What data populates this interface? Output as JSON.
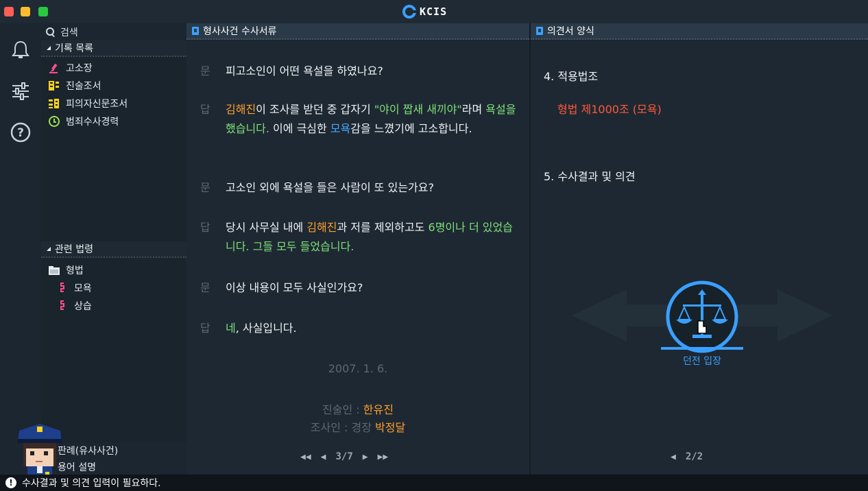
{
  "app": {
    "logo_text": "KCIS"
  },
  "sidebar": {
    "search_label": "검색",
    "records_section": "기록 목록",
    "records": [
      {
        "label": "고소장",
        "icon": "pen-icon"
      },
      {
        "label": "진술조서",
        "icon": "statement-icon"
      },
      {
        "label": "피의자신문조서",
        "icon": "interrogation-icon"
      },
      {
        "label": "범죄수사경력",
        "icon": "clock-icon"
      }
    ],
    "laws_section": "관련 법령",
    "laws_folder": "형법",
    "laws": [
      {
        "label": "모욕"
      },
      {
        "label": "상습"
      }
    ],
    "bottom_items": [
      {
        "label": "판례(유사사건)"
      },
      {
        "label": "용어 설명"
      }
    ]
  },
  "left_panel": {
    "title": "형사사건 수사서류",
    "qa": [
      {
        "tag": "문",
        "parts": [
          {
            "t": "피고소인이 어떤 욕설을 하였나요?",
            "c": ""
          }
        ]
      },
      {
        "tag": "답",
        "parts": [
          {
            "t": "김해진",
            "c": "orange"
          },
          {
            "t": "이 조사를 받던 중 갑자기 ",
            "c": ""
          },
          {
            "t": "\"야이 짭새 새끼야\"",
            "c": "green"
          },
          {
            "t": "라며 ",
            "c": ""
          },
          {
            "t": "욕설을 했습니다.",
            "c": "green"
          },
          {
            "t": " 이에 극심한 ",
            "c": ""
          },
          {
            "t": "모욕",
            "c": "blue"
          },
          {
            "t": "감을 느꼈기에 고소합니다.",
            "c": ""
          }
        ]
      },
      {
        "tag": "문",
        "parts": [
          {
            "t": "고소인 외에 욕설을 들은 사람이 또 있는가요?",
            "c": ""
          }
        ]
      },
      {
        "tag": "답",
        "parts": [
          {
            "t": "당시 사무실 내에 ",
            "c": ""
          },
          {
            "t": "김해진",
            "c": "orange"
          },
          {
            "t": "과 저를 제외하고도 ",
            "c": ""
          },
          {
            "t": "6명이나 더 있었습니다. 그들 모두 들었습니다.",
            "c": "green"
          }
        ]
      },
      {
        "tag": "문",
        "parts": [
          {
            "t": "이상 내용이 모두 사실인가요?",
            "c": ""
          }
        ]
      },
      {
        "tag": "답",
        "parts": [
          {
            "t": "네",
            "c": "green"
          },
          {
            "t": ", 사실입니다.",
            "c": ""
          }
        ]
      }
    ],
    "date": "2007. 1. 6.",
    "statement_by_label": "진술인 : ",
    "statement_by_name": "한유진",
    "investigator_label": "조사인 : 경장 ",
    "investigator_name": "박정달",
    "pager": {
      "current": "3",
      "total": "7",
      "text": "3/7"
    }
  },
  "right_panel": {
    "title": "의견서 양식",
    "section4_title": "4. 적용법조",
    "section4_value": "형법 제1000조 (모욕)",
    "section5_title": "5. 수사결과 및 의견",
    "dungeon_label": "던전 입장",
    "pager": {
      "text": "2/2"
    }
  },
  "status": {
    "message": "수사결과 및 의견 입력이 필요하다."
  },
  "colors": {
    "accent": "#3aa0ff",
    "orange": "#ff9f2e",
    "green": "#7ee07a",
    "red": "#ff5a3c"
  }
}
